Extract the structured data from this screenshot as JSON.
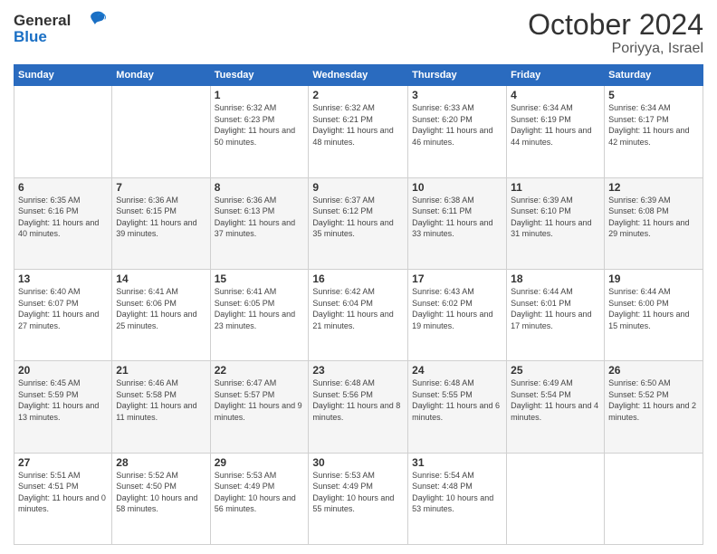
{
  "header": {
    "logo_general": "General",
    "logo_blue": "Blue",
    "month_title": "October 2024",
    "location": "Poriyya, Israel"
  },
  "weekdays": [
    "Sunday",
    "Monday",
    "Tuesday",
    "Wednesday",
    "Thursday",
    "Friday",
    "Saturday"
  ],
  "weeks": [
    [
      {
        "day": "",
        "info": ""
      },
      {
        "day": "",
        "info": ""
      },
      {
        "day": "1",
        "info": "Sunrise: 6:32 AM\nSunset: 6:23 PM\nDaylight: 11 hours and 50 minutes."
      },
      {
        "day": "2",
        "info": "Sunrise: 6:32 AM\nSunset: 6:21 PM\nDaylight: 11 hours and 48 minutes."
      },
      {
        "day": "3",
        "info": "Sunrise: 6:33 AM\nSunset: 6:20 PM\nDaylight: 11 hours and 46 minutes."
      },
      {
        "day": "4",
        "info": "Sunrise: 6:34 AM\nSunset: 6:19 PM\nDaylight: 11 hours and 44 minutes."
      },
      {
        "day": "5",
        "info": "Sunrise: 6:34 AM\nSunset: 6:17 PM\nDaylight: 11 hours and 42 minutes."
      }
    ],
    [
      {
        "day": "6",
        "info": "Sunrise: 6:35 AM\nSunset: 6:16 PM\nDaylight: 11 hours and 40 minutes."
      },
      {
        "day": "7",
        "info": "Sunrise: 6:36 AM\nSunset: 6:15 PM\nDaylight: 11 hours and 39 minutes."
      },
      {
        "day": "8",
        "info": "Sunrise: 6:36 AM\nSunset: 6:13 PM\nDaylight: 11 hours and 37 minutes."
      },
      {
        "day": "9",
        "info": "Sunrise: 6:37 AM\nSunset: 6:12 PM\nDaylight: 11 hours and 35 minutes."
      },
      {
        "day": "10",
        "info": "Sunrise: 6:38 AM\nSunset: 6:11 PM\nDaylight: 11 hours and 33 minutes."
      },
      {
        "day": "11",
        "info": "Sunrise: 6:39 AM\nSunset: 6:10 PM\nDaylight: 11 hours and 31 minutes."
      },
      {
        "day": "12",
        "info": "Sunrise: 6:39 AM\nSunset: 6:08 PM\nDaylight: 11 hours and 29 minutes."
      }
    ],
    [
      {
        "day": "13",
        "info": "Sunrise: 6:40 AM\nSunset: 6:07 PM\nDaylight: 11 hours and 27 minutes."
      },
      {
        "day": "14",
        "info": "Sunrise: 6:41 AM\nSunset: 6:06 PM\nDaylight: 11 hours and 25 minutes."
      },
      {
        "day": "15",
        "info": "Sunrise: 6:41 AM\nSunset: 6:05 PM\nDaylight: 11 hours and 23 minutes."
      },
      {
        "day": "16",
        "info": "Sunrise: 6:42 AM\nSunset: 6:04 PM\nDaylight: 11 hours and 21 minutes."
      },
      {
        "day": "17",
        "info": "Sunrise: 6:43 AM\nSunset: 6:02 PM\nDaylight: 11 hours and 19 minutes."
      },
      {
        "day": "18",
        "info": "Sunrise: 6:44 AM\nSunset: 6:01 PM\nDaylight: 11 hours and 17 minutes."
      },
      {
        "day": "19",
        "info": "Sunrise: 6:44 AM\nSunset: 6:00 PM\nDaylight: 11 hours and 15 minutes."
      }
    ],
    [
      {
        "day": "20",
        "info": "Sunrise: 6:45 AM\nSunset: 5:59 PM\nDaylight: 11 hours and 13 minutes."
      },
      {
        "day": "21",
        "info": "Sunrise: 6:46 AM\nSunset: 5:58 PM\nDaylight: 11 hours and 11 minutes."
      },
      {
        "day": "22",
        "info": "Sunrise: 6:47 AM\nSunset: 5:57 PM\nDaylight: 11 hours and 9 minutes."
      },
      {
        "day": "23",
        "info": "Sunrise: 6:48 AM\nSunset: 5:56 PM\nDaylight: 11 hours and 8 minutes."
      },
      {
        "day": "24",
        "info": "Sunrise: 6:48 AM\nSunset: 5:55 PM\nDaylight: 11 hours and 6 minutes."
      },
      {
        "day": "25",
        "info": "Sunrise: 6:49 AM\nSunset: 5:54 PM\nDaylight: 11 hours and 4 minutes."
      },
      {
        "day": "26",
        "info": "Sunrise: 6:50 AM\nSunset: 5:52 PM\nDaylight: 11 hours and 2 minutes."
      }
    ],
    [
      {
        "day": "27",
        "info": "Sunrise: 5:51 AM\nSunset: 4:51 PM\nDaylight: 11 hours and 0 minutes."
      },
      {
        "day": "28",
        "info": "Sunrise: 5:52 AM\nSunset: 4:50 PM\nDaylight: 10 hours and 58 minutes."
      },
      {
        "day": "29",
        "info": "Sunrise: 5:53 AM\nSunset: 4:49 PM\nDaylight: 10 hours and 56 minutes."
      },
      {
        "day": "30",
        "info": "Sunrise: 5:53 AM\nSunset: 4:49 PM\nDaylight: 10 hours and 55 minutes."
      },
      {
        "day": "31",
        "info": "Sunrise: 5:54 AM\nSunset: 4:48 PM\nDaylight: 10 hours and 53 minutes."
      },
      {
        "day": "",
        "info": ""
      },
      {
        "day": "",
        "info": ""
      }
    ]
  ]
}
